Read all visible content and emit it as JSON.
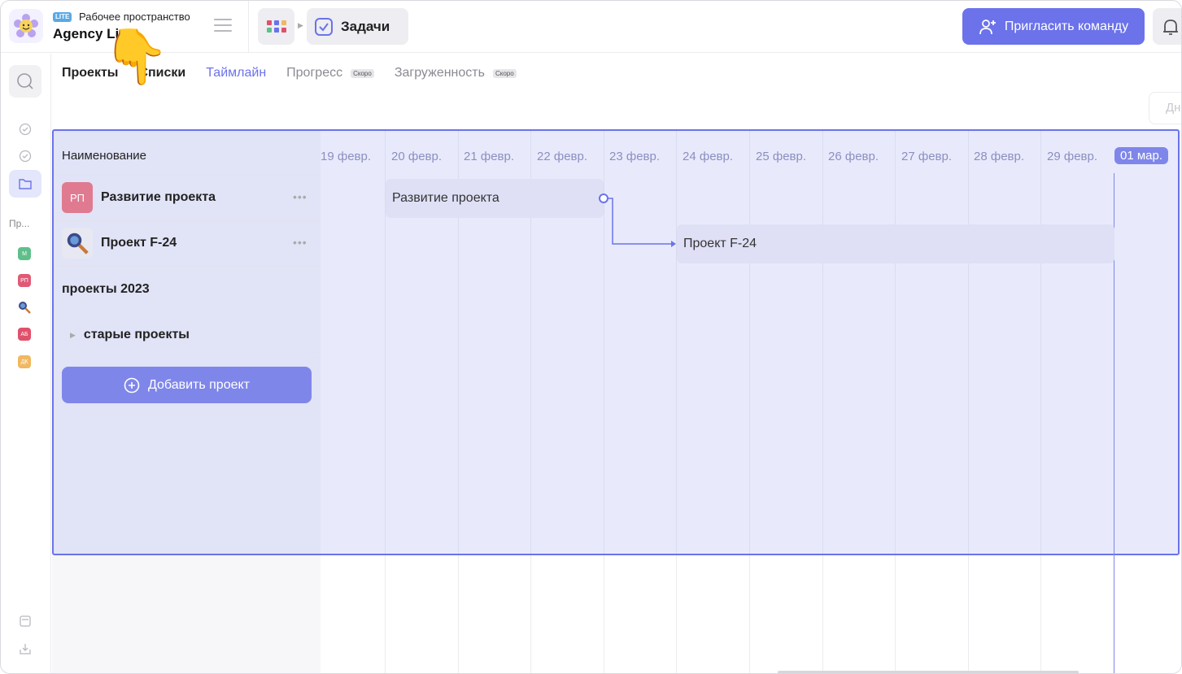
{
  "header": {
    "ws_badge": "LITE",
    "ws_label": "Рабочее пространство",
    "ws_name": "Agency Lite",
    "breadcrumb_current": "Задачи",
    "invite_label": "Пригласить команду"
  },
  "sidebar": {
    "section_label": "Пр...",
    "projects": [
      {
        "abbr": "М",
        "color": "#5fbf8a"
      },
      {
        "abbr": "РП",
        "color": "#e05a76"
      },
      {
        "abbr": "",
        "color": "#3a4a8a"
      },
      {
        "abbr": "АБ",
        "color": "#e0506a"
      },
      {
        "abbr": "ДК",
        "color": "#f0b860"
      }
    ]
  },
  "tabs": [
    {
      "label": "Проекты",
      "state": "bold"
    },
    {
      "label": "Списки",
      "state": "bold"
    },
    {
      "label": "Таймлайн",
      "state": "active"
    },
    {
      "label": "Прогресс",
      "badge": "Скоро"
    },
    {
      "label": "Загруженность",
      "badge": "Скоро"
    }
  ],
  "view_button": "Дн",
  "table": {
    "column_header": "Наименование",
    "rows": [
      {
        "abbr": "РП",
        "label": "Развитие проекта",
        "color": "#e07a90"
      },
      {
        "abbr": "",
        "label": "Проект F-24",
        "color": "#e8e8f3"
      }
    ],
    "group_label": "проекты 2023",
    "folder_label": "старые проекты",
    "add_label": "Добавить проект"
  },
  "timeline": {
    "dates": [
      "19 февр.",
      "20 февр.",
      "21 февр.",
      "22 февр.",
      "23 февр.",
      "24 февр.",
      "25 февр.",
      "26 февр.",
      "27 февр.",
      "28 февр.",
      "29 февр.",
      "01 мар."
    ],
    "today": "01 мар.",
    "bars": [
      {
        "label": "Развитие проекта",
        "start": "20 февр.",
        "end": "22 февр."
      },
      {
        "label": "Проект F-24",
        "start": "24 февр.",
        "end": "29 февр."
      }
    ]
  }
}
